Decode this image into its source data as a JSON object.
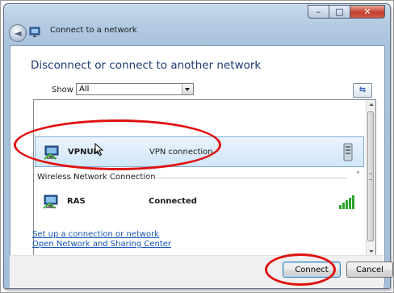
{
  "window": {
    "title": "Connect to a network",
    "controls": {
      "minimize": "–",
      "maximize": "□",
      "close": "✕"
    }
  },
  "nav": {
    "back_icon": "arrow-left-icon",
    "back_glyph": "◄"
  },
  "main": {
    "heading": "Disconnect or connect to another network",
    "show": {
      "label": "Show",
      "value": "All"
    },
    "refresh_glyph": "⇆"
  },
  "list": {
    "vpn_item": {
      "name": "VPNUK",
      "type": "VPN connection",
      "icon": "vpn-network-icon",
      "status_icon": "server-icon"
    },
    "group": {
      "label": "Wireless Network Connection",
      "collapse_glyph": "˄"
    },
    "ras_item": {
      "name": "RAS",
      "status": "Connected",
      "icon": "network-connection-icon",
      "signal_icon": "signal-strength-icon",
      "signal_bars": 5
    }
  },
  "links": {
    "setup": "Set up a connection or network",
    "sharing_center": "Open Network and Sharing Center"
  },
  "footer": {
    "connect_label": "Connect",
    "cancel_label": "Cancel"
  },
  "colors": {
    "annotation": "#e01010",
    "heading": "#1e3a72",
    "link": "#1553b8",
    "selection": "#cfe6f8"
  }
}
